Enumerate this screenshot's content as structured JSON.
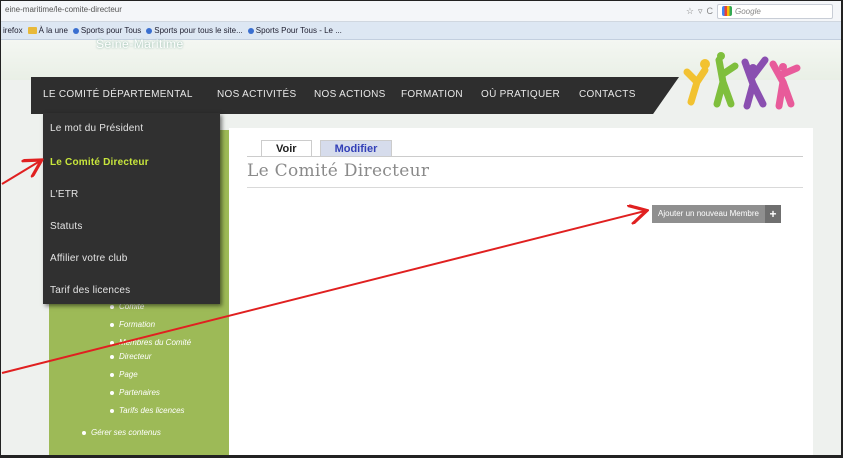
{
  "browser": {
    "url": "eine-maritime/le-comite-directeur",
    "search_placeholder": "Google",
    "bookmarks": [
      "irefox",
      "À la une",
      "Sports pour Tous",
      "Sports pour tous le site...",
      "Sports Pour Tous - Le ..."
    ]
  },
  "site": {
    "name_partial": "Seine-Maritime",
    "nav": [
      "LE COMITÉ DÉPARTEMENTAL",
      "NOS ACTIVITÉS",
      "NOS ACTIONS",
      "FORMATION",
      "OÙ PRATIQUER",
      "CONTACTS"
    ]
  },
  "dropdown": {
    "items": [
      "Le mot du Président",
      "Le Comité Directeur",
      "L'ETR",
      "Statuts",
      "Affilier votre club",
      "Tarif des licences"
    ],
    "active_index": 1
  },
  "content": {
    "tabs": [
      "Voir",
      "Modifier"
    ],
    "title": "Le Comité Directeur",
    "add_button": "Ajouter un nouveau Membre",
    "add_plus": "+"
  },
  "sidebar": {
    "subitems": [
      "Comité",
      "Formation",
      "Membres du Comité",
      "Directeur",
      "Page",
      "Partenaires",
      "Tarifs des licences"
    ],
    "manage": "Gérer ses contenus"
  },
  "colors": {
    "nav_bg": "#2e2e2e",
    "sidebar_green": "#9dba57",
    "active_link": "#c8e63c",
    "annotation_arrow": "#e02020"
  }
}
